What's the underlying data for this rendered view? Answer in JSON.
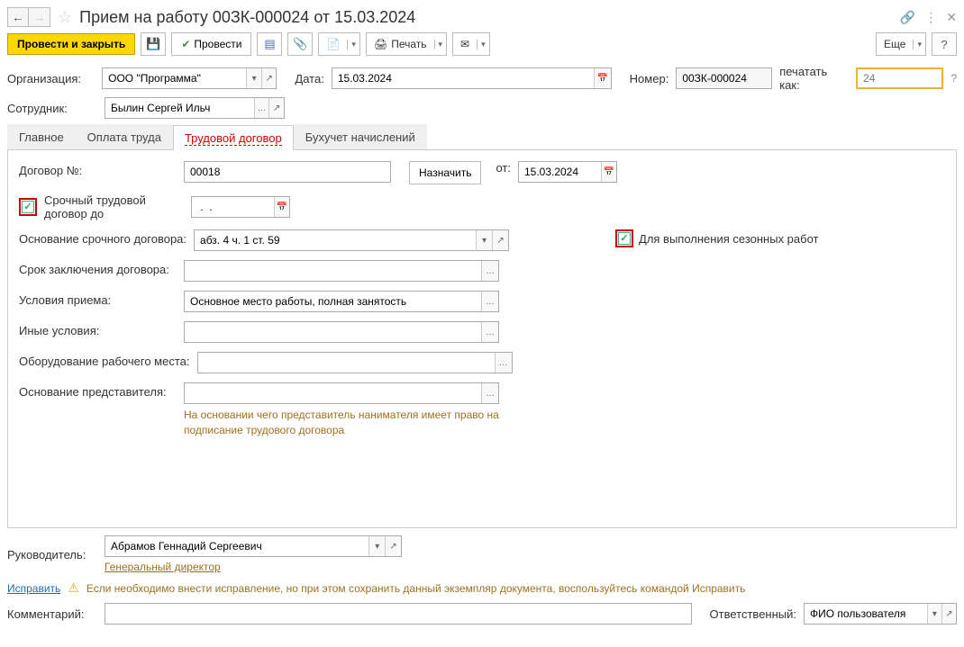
{
  "title": "Прием на работу 00ЗК-000024 от 15.03.2024",
  "toolbar": {
    "post_close": "Провести и закрыть",
    "post": "Провести",
    "print": "Печать",
    "more": "Еще"
  },
  "header": {
    "org_label": "Организация:",
    "org_value": "ООО \"Программа\"",
    "date_label": "Дата:",
    "date_value": "15.03.2024",
    "number_label": "Номер:",
    "number_value": "00ЗК-000024",
    "print_as_label": "печатать как:",
    "print_as_placeholder": "24",
    "employee_label": "Сотрудник:",
    "employee_value": "Былин Сергей Ильч"
  },
  "tabs": {
    "main": "Главное",
    "payment": "Оплата труда",
    "contract": "Трудовой договор",
    "accounting": "Бухучет начислений"
  },
  "contract": {
    "number_label": "Договор №:",
    "number_value": "00018",
    "assign": "Назначить",
    "from_label": "от:",
    "from_value": "15.03.2024",
    "fixed_term_label": "Срочный трудовой договор до",
    "fixed_term_date": " .  .    ",
    "basis_label": "Основание срочного договора:",
    "basis_value": "абз. 4 ч. 1 ст. 59",
    "seasonal_label": "Для выполнения сезонных работ",
    "term_label": "Срок заключения договора:",
    "conditions_label": "Условия приема:",
    "conditions_value": "Основное место работы, полная занятость",
    "other_label": "Иные условия:",
    "equipment_label": "Оборудование рабочего места:",
    "rep_basis_label": "Основание представителя:",
    "rep_hint": "На основании чего представитель нанимателя имеет право на подписание трудового договора"
  },
  "footer": {
    "manager_label": "Руководитель:",
    "manager_value": "Абрамов Геннадий Сергеевич",
    "manager_position": "Генеральный директор",
    "fix_link": "Исправить",
    "fix_hint": "Если необходимо внести исправление, но при этом сохранить данный экземпляр документа, воспользуйтесь командой Исправить",
    "comment_label": "Комментарий:",
    "responsible_label": "Ответственный:",
    "responsible_value": "ФИО пользователя"
  }
}
